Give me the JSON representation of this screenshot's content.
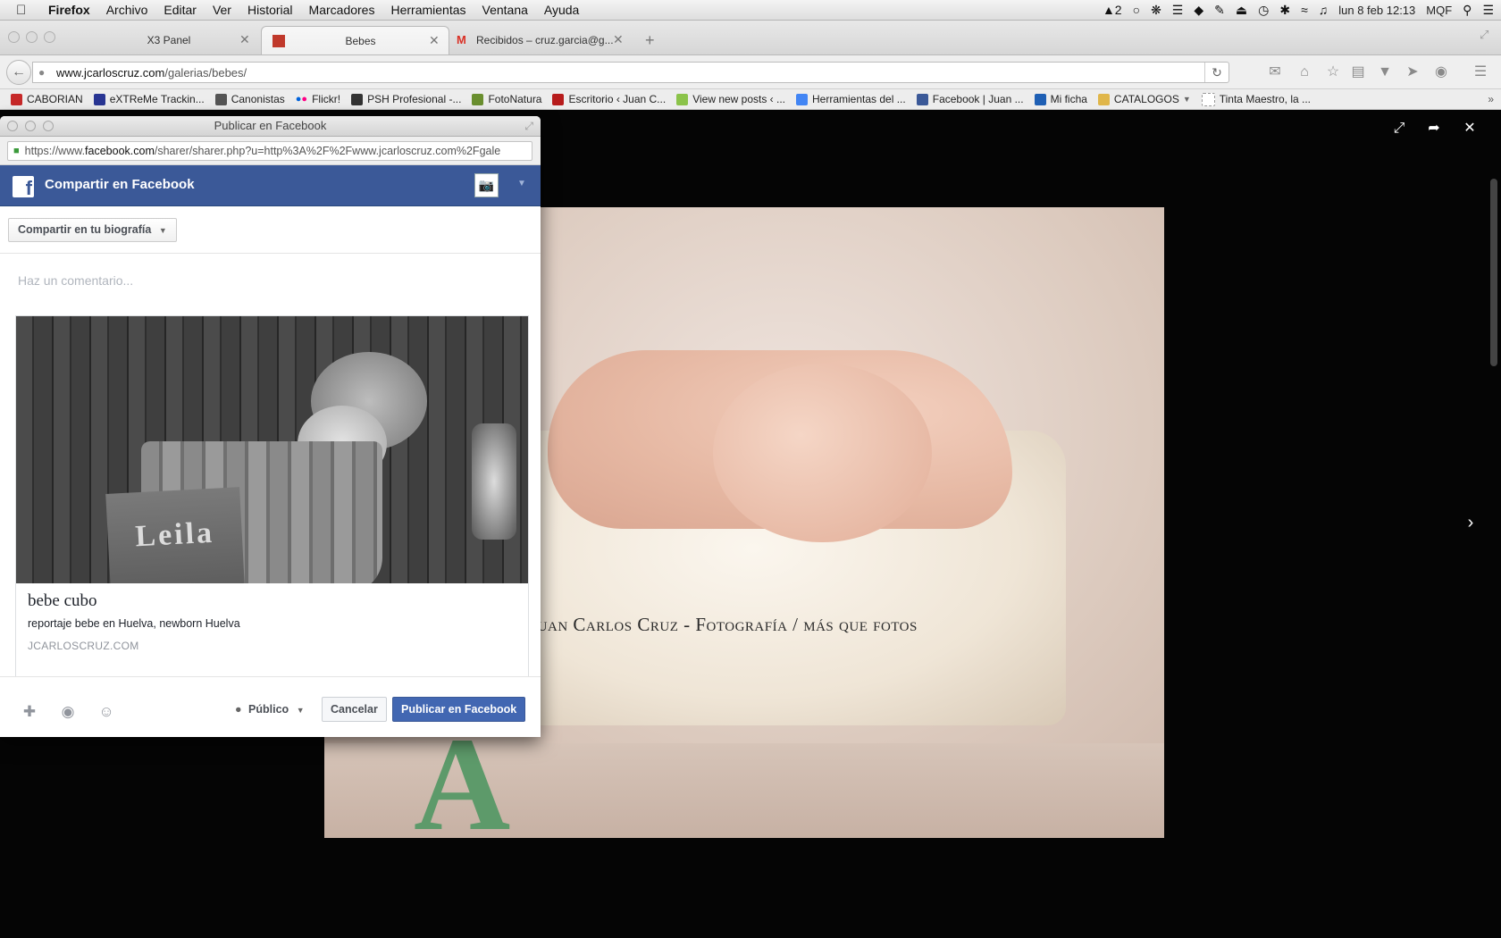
{
  "menubar": {
    "apple_icon": "apple-logo-icon",
    "items": [
      "Firefox",
      "Archivo",
      "Editar",
      "Ver",
      "Historial",
      "Marcadores",
      "Herramientas",
      "Ventana",
      "Ayuda"
    ],
    "status_badge": "2",
    "clock": "lun 8 feb  12:13",
    "user": "MQF"
  },
  "tabs": [
    {
      "label": "X3 Panel",
      "active": false
    },
    {
      "label": "Bebes",
      "active": true
    },
    {
      "label": "Recibidos – cruz.garcia@g...",
      "active": false
    }
  ],
  "navbar": {
    "url_host": "www.jcarloscruz.com",
    "url_path": "/galerias/bebes/"
  },
  "bookmarks": [
    {
      "label": "CABORIAN",
      "color": "#c62828"
    },
    {
      "label": "eXTReMe Trackin...",
      "color": "#283593"
    },
    {
      "label": "Canonistas",
      "color": "#555555"
    },
    {
      "label": "Flickr!",
      "color": "#0063dc"
    },
    {
      "label": "PSH Profesional -...",
      "color": "#333333"
    },
    {
      "label": "FotoNatura",
      "color": "#6a8f2f"
    },
    {
      "label": "Escritorio ‹ Juan C...",
      "color": "#b71c1c"
    },
    {
      "label": "View new posts ‹ ...",
      "color": "#8bc34a"
    },
    {
      "label": "Herramientas del ...",
      "color": "#4285f4"
    },
    {
      "label": "Facebook | Juan ...",
      "color": "#3b5998"
    },
    {
      "label": "Mi ficha",
      "color": "#1e5fb4"
    },
    {
      "label": "CATALOGOS",
      "color": "#e0b64a"
    },
    {
      "label": "Tinta Maestro, la ...",
      "color": "#ffffff"
    }
  ],
  "gallery": {
    "watermark": "Juan Carlos Cruz - Fotografía / más que fotos"
  },
  "popup": {
    "window_title": "Publicar en Facebook",
    "url_prefix": "https://www.",
    "url_host": "facebook.com",
    "url_rest": "/sharer/sharer.php?u=http%3A%2F%2Fwww.jcarloscruz.com%2Fgale",
    "header_title": "Compartir en Facebook",
    "share_target": "Compartir en tu biografía",
    "comment_placeholder": "Haz un comentario...",
    "card": {
      "sign_text": "Leila",
      "title": "bebe cubo",
      "description": "reportaje bebe en Huelva, newborn Huelva",
      "domain": "JCARLOSCRUZ.COM"
    },
    "audience": "Público",
    "cancel_label": "Cancelar",
    "publish_label": "Publicar en Facebook"
  },
  "colors": {
    "facebook_blue": "#3b5998",
    "publish_button": "#4267b2"
  }
}
